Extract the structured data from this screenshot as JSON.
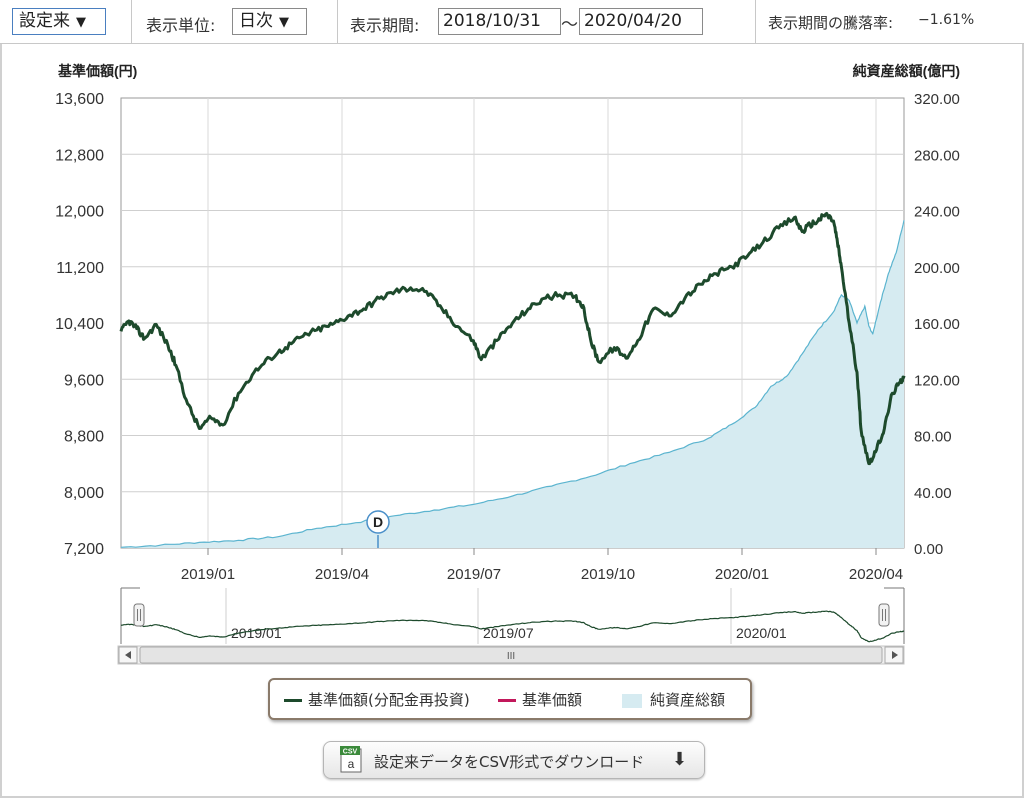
{
  "toolbar": {
    "period_select": "設定来",
    "unit_label": "表示単位:",
    "unit_select": "日次",
    "period_label": "表示期間:",
    "date_from": "2018/10/31",
    "date_sep": "〜",
    "date_to": "2020/04/20",
    "change_label": "表示期間の騰落率:",
    "change_value": "−1.61%"
  },
  "chart_data": {
    "type": "line",
    "x_ticks": [
      "2019/01",
      "2019/04",
      "2019/07",
      "2019/10",
      "2020/01",
      "2020/04"
    ],
    "y_left": {
      "label": "基準価額(円)",
      "ticks": [
        "13,600",
        "12,800",
        "12,000",
        "11,200",
        "10,400",
        "9,600",
        "8,800",
        "8,000",
        "7,200"
      ],
      "range": [
        7200,
        13600
      ]
    },
    "y_right": {
      "label": "純資産総額(億円)",
      "ticks": [
        "320.00",
        "280.00",
        "240.00",
        "200.00",
        "160.00",
        "120.00",
        "80.00",
        "40.00",
        "0.00"
      ],
      "range": [
        0,
        320
      ]
    },
    "marker": {
      "label": "D",
      "date": "2019/05"
    },
    "nav_ticks": [
      "2019/01",
      "2019/07",
      "2020/01"
    ],
    "nav_scroll_label": "III",
    "series": [
      {
        "name": "基準価額(分配金再投資)",
        "axis": "left",
        "color": "#1d4a2c",
        "points": [
          [
            0,
            10280
          ],
          [
            0.01,
            10430
          ],
          [
            0.02,
            10320
          ],
          [
            0.03,
            10180
          ],
          [
            0.045,
            10380
          ],
          [
            0.06,
            10080
          ],
          [
            0.07,
            9800
          ],
          [
            0.085,
            9250
          ],
          [
            0.1,
            8900
          ],
          [
            0.115,
            9050
          ],
          [
            0.13,
            8950
          ],
          [
            0.15,
            9400
          ],
          [
            0.17,
            9700
          ],
          [
            0.19,
            9900
          ],
          [
            0.21,
            10050
          ],
          [
            0.23,
            10200
          ],
          [
            0.25,
            10300
          ],
          [
            0.27,
            10380
          ],
          [
            0.29,
            10500
          ],
          [
            0.31,
            10600
          ],
          [
            0.33,
            10750
          ],
          [
            0.35,
            10850
          ],
          [
            0.37,
            10900
          ],
          [
            0.39,
            10850
          ],
          [
            0.41,
            10600
          ],
          [
            0.43,
            10350
          ],
          [
            0.45,
            10150
          ],
          [
            0.46,
            9880
          ],
          [
            0.48,
            10150
          ],
          [
            0.5,
            10400
          ],
          [
            0.52,
            10600
          ],
          [
            0.54,
            10750
          ],
          [
            0.56,
            10800
          ],
          [
            0.58,
            10780
          ],
          [
            0.59,
            10650
          ],
          [
            0.6,
            10150
          ],
          [
            0.61,
            9850
          ],
          [
            0.63,
            10050
          ],
          [
            0.645,
            9900
          ],
          [
            0.66,
            10150
          ],
          [
            0.68,
            10600
          ],
          [
            0.7,
            10500
          ],
          [
            0.72,
            10750
          ],
          [
            0.74,
            10950
          ],
          [
            0.76,
            11100
          ],
          [
            0.78,
            11200
          ],
          [
            0.8,
            11350
          ],
          [
            0.82,
            11550
          ],
          [
            0.84,
            11750
          ],
          [
            0.86,
            11900
          ],
          [
            0.87,
            11700
          ],
          [
            0.88,
            11800
          ],
          [
            0.89,
            11850
          ],
          [
            0.9,
            11950
          ],
          [
            0.91,
            11850
          ],
          [
            0.915,
            11550
          ],
          [
            0.92,
            11200
          ],
          [
            0.93,
            10400
          ],
          [
            0.94,
            9700
          ],
          [
            0.945,
            8900
          ],
          [
            0.955,
            8400
          ],
          [
            0.965,
            8600
          ],
          [
            0.975,
            8900
          ],
          [
            0.985,
            9400
          ],
          [
            0.995,
            9550
          ],
          [
            1.0,
            9650
          ]
        ]
      },
      {
        "name": "基準価額",
        "axis": "left",
        "color": "#c2185b",
        "points": []
      },
      {
        "name": "純資産総額",
        "axis": "right",
        "type": "area",
        "color": "#5bb4cf",
        "fill": "#d6ebf1",
        "points": [
          [
            0,
            0.5
          ],
          [
            0.05,
            2
          ],
          [
            0.1,
            4
          ],
          [
            0.15,
            5.5
          ],
          [
            0.2,
            8
          ],
          [
            0.25,
            14
          ],
          [
            0.3,
            18
          ],
          [
            0.35,
            23
          ],
          [
            0.4,
            27
          ],
          [
            0.45,
            31
          ],
          [
            0.5,
            37
          ],
          [
            0.55,
            44
          ],
          [
            0.6,
            51
          ],
          [
            0.65,
            60
          ],
          [
            0.7,
            68
          ],
          [
            0.75,
            78
          ],
          [
            0.78,
            88
          ],
          [
            0.81,
            100
          ],
          [
            0.83,
            115
          ],
          [
            0.85,
            122
          ],
          [
            0.87,
            138
          ],
          [
            0.89,
            155
          ],
          [
            0.91,
            168
          ],
          [
            0.92,
            180
          ],
          [
            0.93,
            176
          ],
          [
            0.94,
            160
          ],
          [
            0.95,
            172
          ],
          [
            0.955,
            158
          ],
          [
            0.96,
            152
          ],
          [
            0.97,
            175
          ],
          [
            0.98,
            195
          ],
          [
            0.99,
            210
          ],
          [
            1.0,
            233
          ]
        ]
      }
    ]
  },
  "legend": [
    {
      "label": "基準価額(分配金再投資)",
      "color": "#1d4a2c",
      "kind": "line"
    },
    {
      "label": "基準価額",
      "color": "#c2185b",
      "kind": "line"
    },
    {
      "label": "純資産総額",
      "color": "#d6ebf1",
      "kind": "box"
    }
  ],
  "download": {
    "label": "設定来データをCSV形式でダウンロード",
    "icon_text": "CSV",
    "icon_letter": "a"
  }
}
